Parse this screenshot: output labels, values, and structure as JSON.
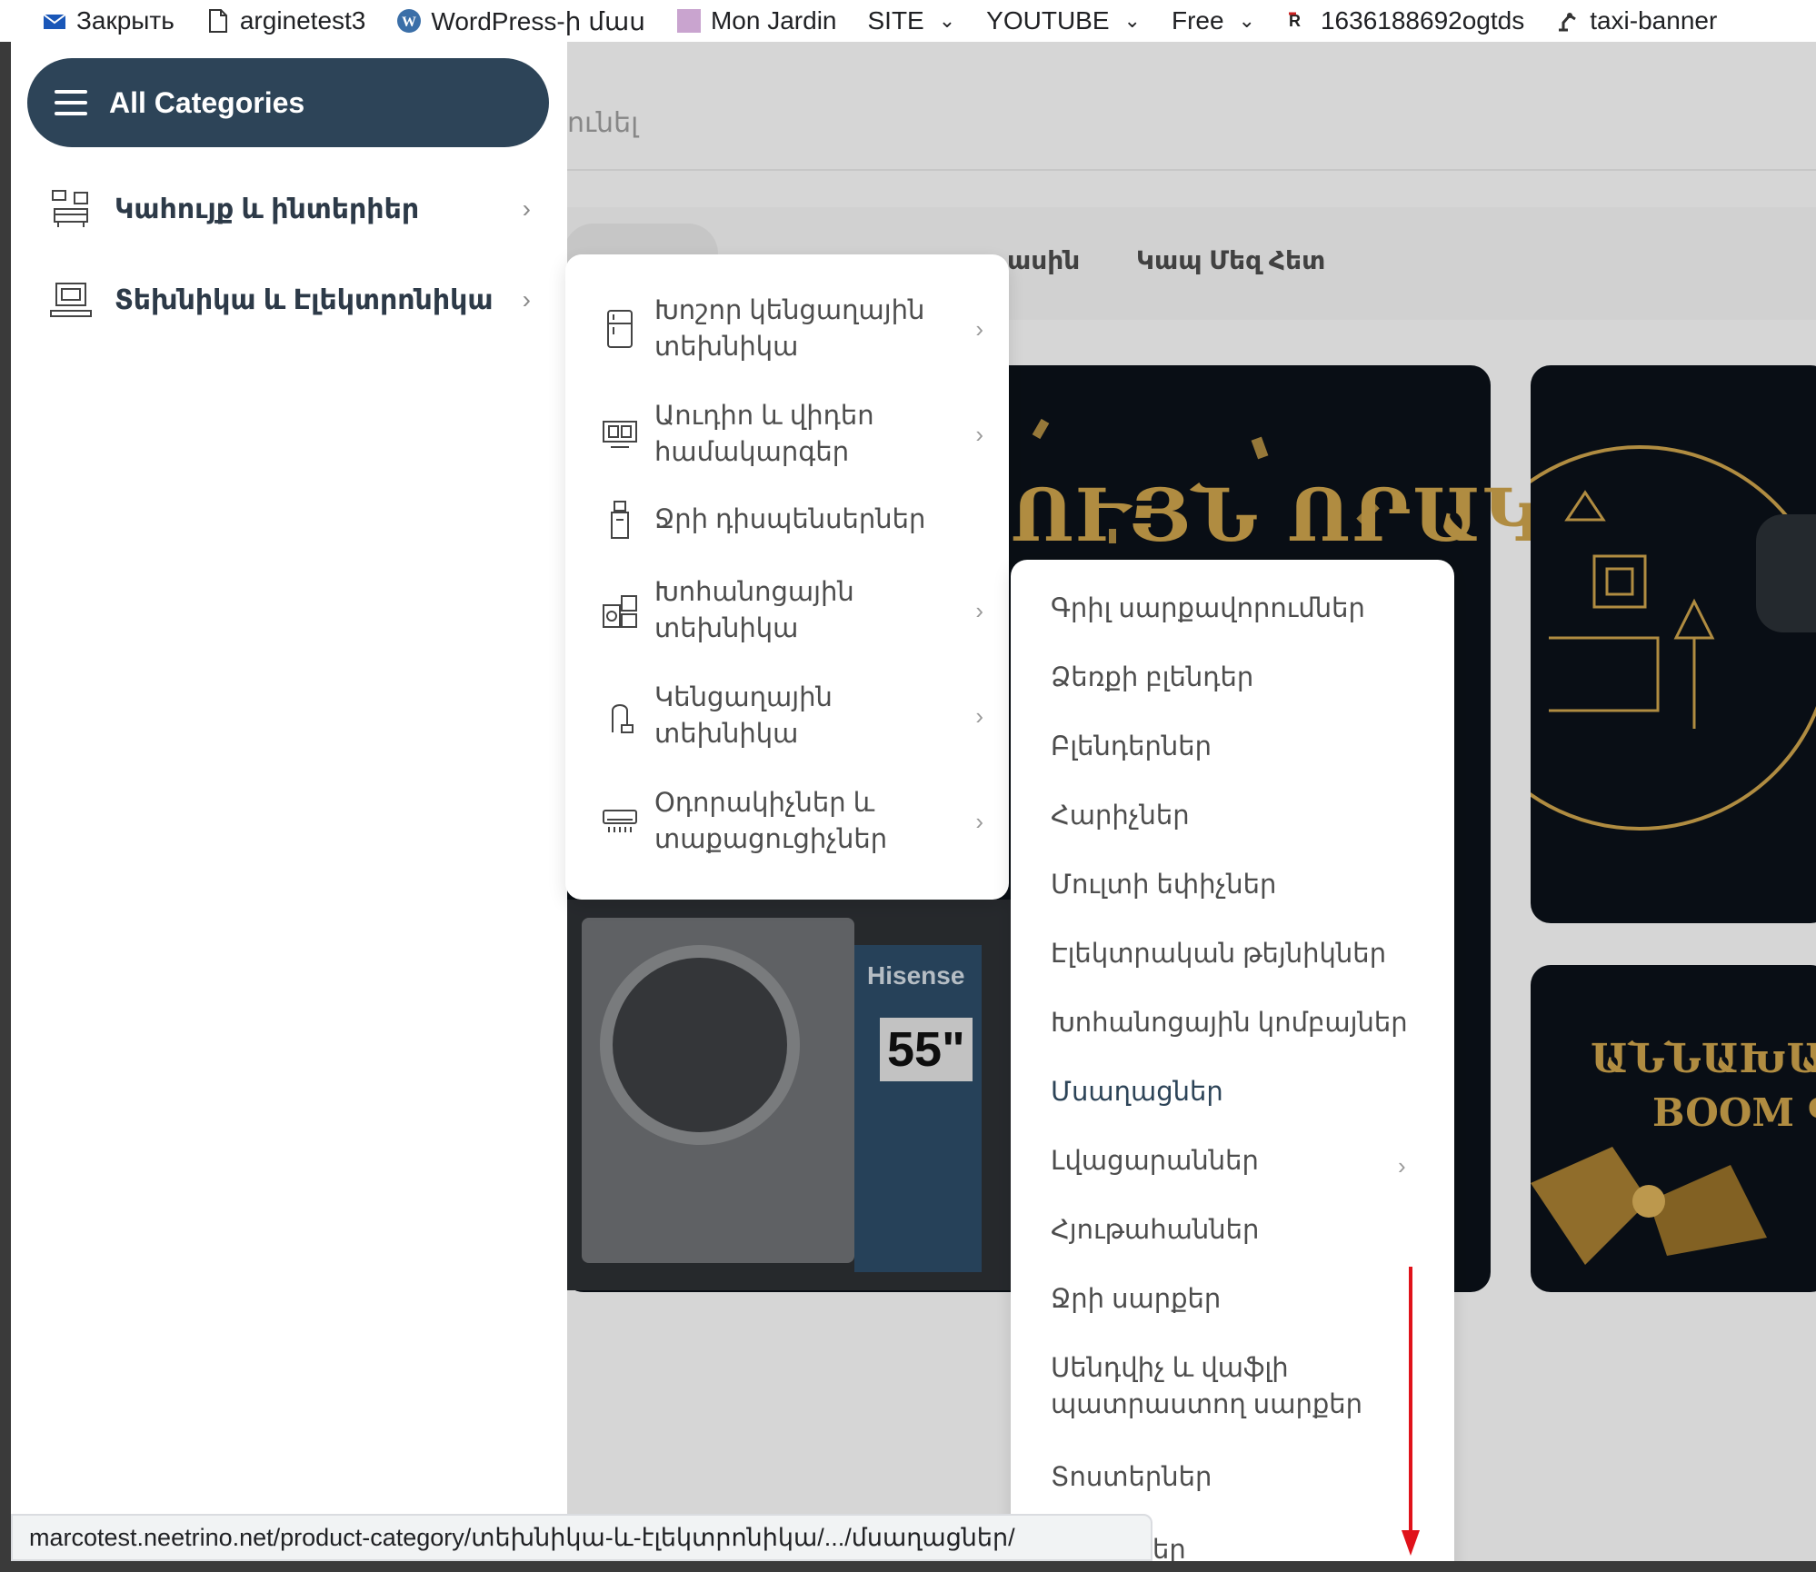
{
  "bookmarks": [
    {
      "label": "Закрыть",
      "icon": "mail-icon"
    },
    {
      "label": "arginetest3",
      "icon": "document-icon"
    },
    {
      "label": "WordPress-ի մաս",
      "icon": "wordpress-icon"
    },
    {
      "label": "Mon Jardin",
      "icon": "purple-square-icon"
    },
    {
      "label": "SITE",
      "icon": "chevron-down-icon"
    },
    {
      "label": "YOUTUBE",
      "icon": "chevron-down-icon"
    },
    {
      "label": "Free",
      "icon": "chevron-down-icon"
    },
    {
      "label": "1636188692ogtds",
      "icon": "realty-logo-icon"
    },
    {
      "label": "taxi-banner",
      "icon": "robot-arm-icon"
    }
  ],
  "background_page": {
    "search_fragment": "ունել",
    "nav_items": [
      "ասին",
      "Կապ Մեզ Հետ"
    ],
    "banner_title": "ՈՒՅՆ ՈՐԱԿ",
    "promo_line1": "ԱՆՆԱԽԱԴԵՊ ԶԵՂՉ",
    "promo_line2": "BOOM ԳՆԵՐ",
    "tv_brand": "Hisense",
    "tv_size": "55\""
  },
  "categories_header": {
    "label": "All Categories",
    "bg_color": "#2d4458"
  },
  "categories": [
    {
      "label": "Կահույք և ինտերիեր",
      "icon": "furniture-icon"
    },
    {
      "label": "Տեխնիկա և Էլեկտրոնիկա",
      "icon": "electronics-icon"
    }
  ],
  "submenu_electronics": [
    {
      "label": "Խոշոր կենցաղային տեխնիկա",
      "icon": "refrigerator-icon",
      "has_children": true
    },
    {
      "label": "Աուդիո և վիդեո համակարգեր",
      "icon": "tv-icon",
      "has_children": true
    },
    {
      "label": "Ջրի դիսպենսերներ",
      "icon": "water-dispenser-icon",
      "has_children": false
    },
    {
      "label": "Խոհանոցային տեխնիկա",
      "icon": "kitchen-appliance-icon",
      "has_children": true
    },
    {
      "label": "Կենցաղային տեխնիկա",
      "icon": "vacuum-icon",
      "has_children": true
    },
    {
      "label": "Օդորակիչներ և տաքացուցիչներ",
      "icon": "air-conditioner-icon",
      "has_children": true
    }
  ],
  "submenu_kitchen": [
    {
      "label": "Գրիլ սարքավորումներ"
    },
    {
      "label": "Ձեռքի բլենդեր"
    },
    {
      "label": "Բլենդերներ"
    },
    {
      "label": "Հարիչներ"
    },
    {
      "label": "Մուլտի եփիչներ"
    },
    {
      "label": "Էլեկտրական թեյնիկներ"
    },
    {
      "label": "Խոհանոցային կոմբայներ"
    },
    {
      "label": "Մսաղացներ",
      "active": true
    },
    {
      "label": "Լվացարաններ",
      "has_children": true
    },
    {
      "label": "Հյութահաններ"
    },
    {
      "label": "Ջրի սարքեր"
    },
    {
      "label": "Սենդվիչ և վաֆլի պատրաստող սարքեր"
    },
    {
      "label": "Տոստերներ"
    }
  ],
  "partial_item_fragment": "եր",
  "status_url": "marcotest.neetrino.net/product-category/տեխնիկա-և-էլեկտրոնիկա/.../մսաղացներ/",
  "colors": {
    "accent": "#2d4458",
    "annotation_arrow": "#e0121a"
  }
}
